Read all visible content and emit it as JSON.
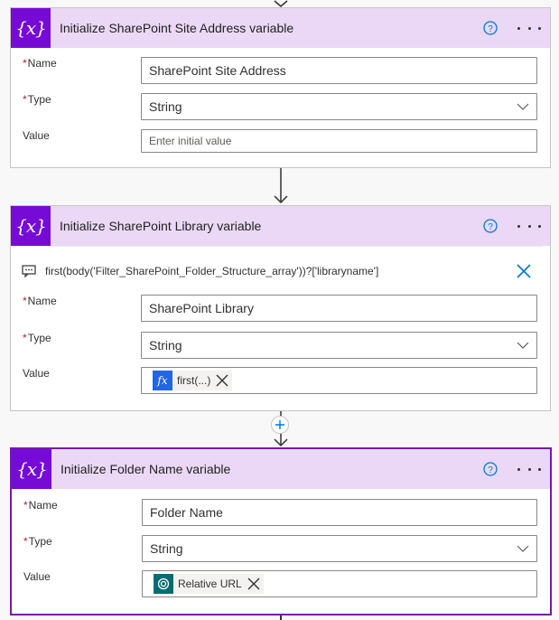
{
  "cards": [
    {
      "title": "Initialize SharePoint Site Address variable",
      "icon_text": "{x}",
      "name_label": "Name",
      "name_value": "SharePoint Site Address",
      "type_label": "Type",
      "type_value": "String",
      "value_label": "Value",
      "value_placeholder": "Enter initial value"
    },
    {
      "title": "Initialize SharePoint Library variable",
      "icon_text": "{x}",
      "comment": "first(body('Filter_SharePoint_Folder_Structure_array'))?['libraryname']",
      "name_label": "Name",
      "name_value": "SharePoint Library",
      "type_label": "Type",
      "type_value": "String",
      "value_label": "Value",
      "value_token": "first(...)",
      "value_token_icon": "fx"
    },
    {
      "title": "Initialize Folder Name variable",
      "icon_text": "{x}",
      "name_label": "Name",
      "name_value": "Folder Name",
      "type_label": "Type",
      "type_value": "String",
      "value_label": "Value",
      "value_token": "Relative URL"
    }
  ],
  "required_marker": "*",
  "colors": {
    "variable_accent": "#770bd6",
    "header_bg": "#ead8f6",
    "selected_border": "#7719aa",
    "fx_token": "#2266e3",
    "sharepoint_token": "#036c70",
    "link_blue": "#0078d4"
  }
}
